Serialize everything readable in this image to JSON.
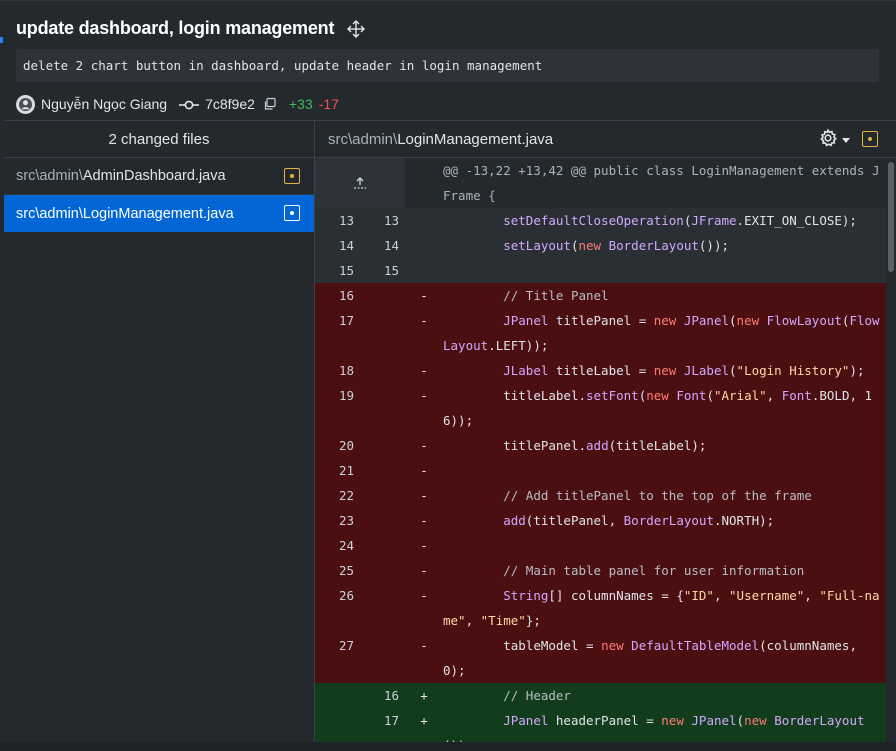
{
  "commit": {
    "title": "update dashboard, login management",
    "description": "delete 2 chart button in dashboard, update header in login management",
    "author": "Nguyễn Ngọc Giang",
    "sha": "7c8f9e2",
    "additions": "+33",
    "deletions": "-17"
  },
  "sidebar": {
    "header": "2 changed files",
    "files": [
      {
        "dir": "src\\admin\\",
        "name": "AdminDashboard.java"
      },
      {
        "dir": "src\\admin\\",
        "name": "LoginManagement.java"
      }
    ]
  },
  "diff": {
    "file_dir": "src\\admin\\",
    "file_name": "LoginManagement.java",
    "hunk": "@@ -13,22 +13,42 @@ public class LoginManagement extends JFrame {",
    "lines": [
      {
        "old": "13",
        "new": "13",
        "type": "ctx",
        "marker": "",
        "code": "        setDefaultCloseOperation(JFrame.EXIT_ON_CLOSE);"
      },
      {
        "old": "14",
        "new": "14",
        "type": "ctx",
        "marker": "",
        "code": "        setLayout(new BorderLayout());"
      },
      {
        "old": "15",
        "new": "15",
        "type": "ctx",
        "marker": "",
        "code": ""
      },
      {
        "old": "16",
        "new": "",
        "type": "del",
        "marker": "-",
        "code": "        // Title Panel"
      },
      {
        "old": "17",
        "new": "",
        "type": "del",
        "marker": "-",
        "code": "        JPanel titlePanel = new JPanel(new FlowLayout(FlowLayout.LEFT));"
      },
      {
        "old": "18",
        "new": "",
        "type": "del",
        "marker": "-",
        "code": "        JLabel titleLabel = new JLabel(\"Login History\");"
      },
      {
        "old": "19",
        "new": "",
        "type": "del",
        "marker": "-",
        "code": "        titleLabel.setFont(new Font(\"Arial\", Font.BOLD, 16));"
      },
      {
        "old": "20",
        "new": "",
        "type": "del",
        "marker": "-",
        "code": "        titlePanel.add(titleLabel);"
      },
      {
        "old": "21",
        "new": "",
        "type": "del",
        "marker": "-",
        "code": ""
      },
      {
        "old": "22",
        "new": "",
        "type": "del",
        "marker": "-",
        "code": "        // Add titlePanel to the top of the frame"
      },
      {
        "old": "23",
        "new": "",
        "type": "del",
        "marker": "-",
        "code": "        add(titlePanel, BorderLayout.NORTH);"
      },
      {
        "old": "24",
        "new": "",
        "type": "del",
        "marker": "-",
        "code": ""
      },
      {
        "old": "25",
        "new": "",
        "type": "del",
        "marker": "-",
        "code": "        // Main table panel for user information"
      },
      {
        "old": "26",
        "new": "",
        "type": "del",
        "marker": "-",
        "code": "        String[] columnNames = {\"ID\", \"Username\", \"Full-name\", \"Time\"};"
      },
      {
        "old": "27",
        "new": "",
        "type": "del",
        "marker": "-",
        "code": "        tableModel = new DefaultTableModel(columnNames, 0);"
      },
      {
        "old": "",
        "new": "16",
        "type": "add",
        "marker": "+",
        "code": "        // Header"
      },
      {
        "old": "",
        "new": "17",
        "type": "add",
        "marker": "+",
        "code": "        JPanel headerPanel = new JPanel(new BorderLayout());"
      }
    ]
  },
  "colors": {
    "accent": "#0366d6",
    "deletion_bg": "#4b0f12",
    "addition_bg": "#113d1c",
    "modified_badge": "#e3b341"
  },
  "icons": [
    "move-icon",
    "avatar-icon",
    "commit-icon",
    "copy-icon",
    "file-modified-icon",
    "gear-icon",
    "expand-up-icon"
  ]
}
